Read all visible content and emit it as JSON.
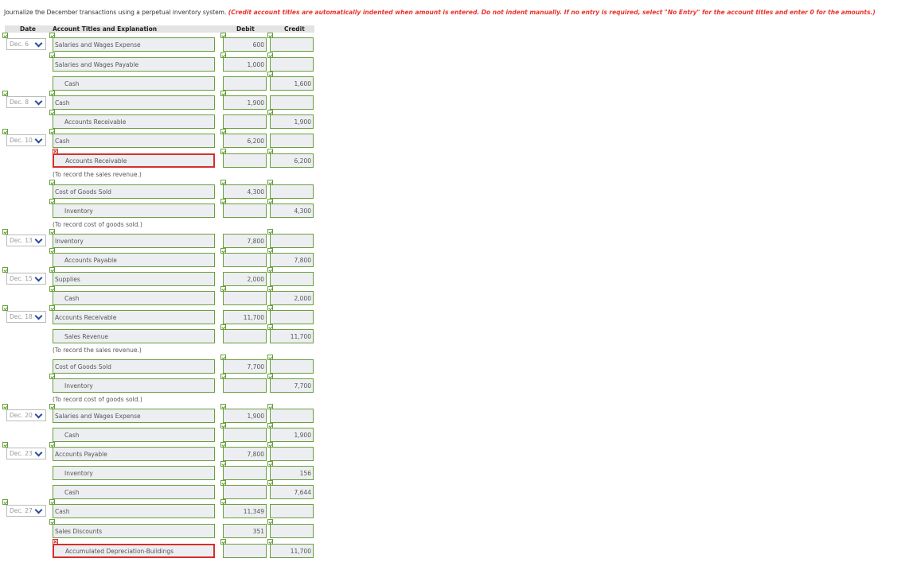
{
  "instructions": {
    "main": "Journalize the December transactions using a perpetual inventory system.",
    "note": "(Credit account titles are automatically indented when amount is entered. Do not indent manually. If no entry is required, select \"No Entry\" for the account titles and enter 0 for the amounts.)"
  },
  "headers": {
    "date": "Date",
    "account": "Account Titles and Explanation",
    "debit": "Debit",
    "credit": "Credit"
  },
  "rows": [
    {
      "date": "Dec. 6",
      "account": "Salaries and Wages Expense",
      "debit": "600",
      "credit": ""
    },
    {
      "date": "",
      "account": "Salaries and Wages Payable",
      "debit": "1,000",
      "credit": ""
    },
    {
      "date": "",
      "account": "Cash",
      "debit": "",
      "credit": "1,600"
    },
    {
      "date": "Dec. 8",
      "account": "Cash",
      "debit": "1,900",
      "credit": ""
    },
    {
      "date": "",
      "account": "Accounts Receivable",
      "debit": "",
      "credit": "1,900"
    },
    {
      "date": "Dec. 10",
      "account": "Cash",
      "debit": "6,200",
      "credit": ""
    },
    {
      "date": "",
      "account": "Accounts Receivable",
      "debit": "",
      "credit": "6,200"
    },
    {
      "memo": "(To record the sales revenue.)"
    },
    {
      "date": "",
      "account": "Cost of Goods Sold",
      "debit": "4,300",
      "credit": ""
    },
    {
      "date": "",
      "account": "Inventory",
      "debit": "",
      "credit": "4,300"
    },
    {
      "memo": "(To record cost of goods sold.)"
    },
    {
      "date": "Dec. 13",
      "account": "Inventory",
      "debit": "7,800",
      "credit": ""
    },
    {
      "date": "",
      "account": "Accounts Payable",
      "debit": "",
      "credit": "7,800"
    },
    {
      "date": "Dec. 15",
      "account": "Supplies",
      "debit": "2,000",
      "credit": ""
    },
    {
      "date": "",
      "account": "Cash",
      "debit": "",
      "credit": "2,000"
    },
    {
      "date": "Dec. 18",
      "account": "Accounts Receivable",
      "debit": "11,700",
      "credit": ""
    },
    {
      "date": "",
      "account": "Sales Revenue",
      "debit": "",
      "credit": "11,700"
    },
    {
      "memo": "(To record the sales revenue.)"
    },
    {
      "date": "",
      "account": "Cost of Goods Sold",
      "debit": "7,700",
      "credit": ""
    },
    {
      "date": "",
      "account": "Inventory",
      "debit": "",
      "credit": "7,700"
    },
    {
      "memo": "(To record cost of goods sold.)"
    },
    {
      "date": "Dec. 20",
      "account": "Salaries and Wages Expense",
      "debit": "1,900",
      "credit": ""
    },
    {
      "date": "",
      "account": "Cash",
      "debit": "",
      "credit": "1,900"
    },
    {
      "date": "Dec. 23",
      "account": "Accounts Payable",
      "debit": "7,800",
      "credit": ""
    },
    {
      "date": "",
      "account": "Inventory",
      "debit": "",
      "credit": "156"
    },
    {
      "date": "",
      "account": "Cash",
      "debit": "",
      "credit": "7,644"
    },
    {
      "date": "Dec. 27",
      "account": "Cash",
      "debit": "11,349",
      "credit": ""
    },
    {
      "date": "",
      "account": "Sales Discounts",
      "debit": "351",
      "credit": ""
    },
    {
      "date": "",
      "account": "Accumulated Depreciation-Buildings",
      "debit": "",
      "credit": "11,700"
    }
  ]
}
